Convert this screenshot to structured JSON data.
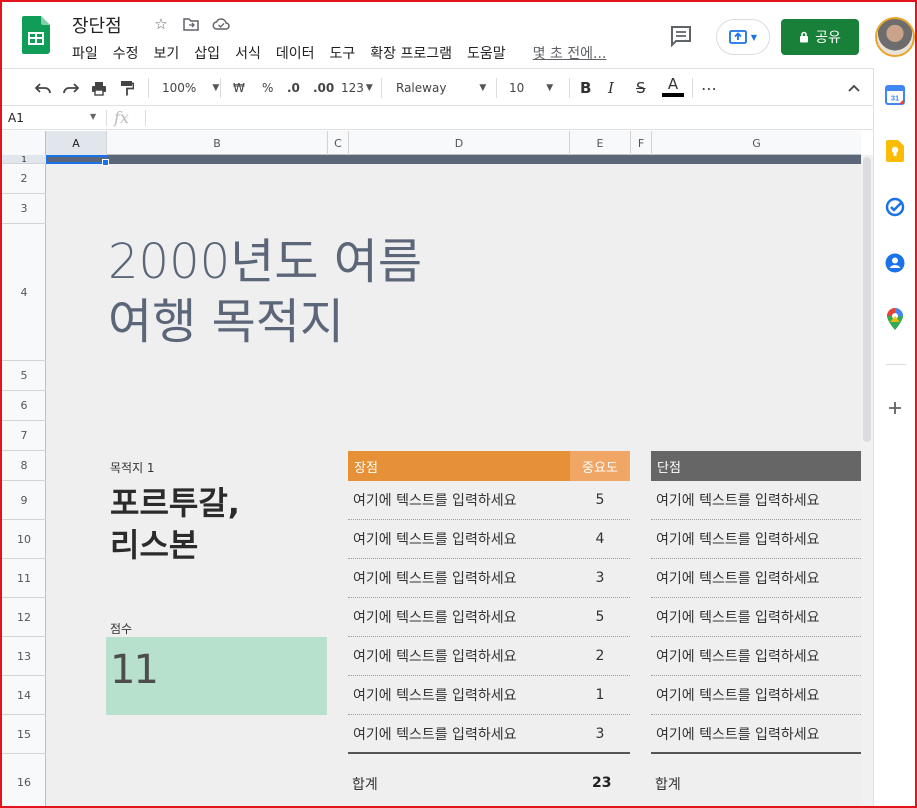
{
  "title_bar": {
    "doc_title": "장단점",
    "menu": [
      "파일",
      "수정",
      "보기",
      "삽입",
      "서식",
      "데이터",
      "도구",
      "확장 프로그램",
      "도움말"
    ],
    "last_edit": "몇 초 전에...",
    "share_label": "공유"
  },
  "toolbar": {
    "zoom": "100%",
    "currency": "₩",
    "percent": "%",
    "dec_decrease": ".0",
    "dec_increase": ".00",
    "number_format": "123",
    "font": "Raleway",
    "font_size": "10",
    "bold": "B",
    "italic": "I",
    "strike": "S",
    "text_color": "A",
    "more": "⋯"
  },
  "formula_bar": {
    "cell_ref": "A1",
    "fx": "fx"
  },
  "columns": [
    "A",
    "B",
    "C",
    "D",
    "E",
    "F",
    "G"
  ],
  "rows": [
    "1",
    "2",
    "3",
    "4",
    "5",
    "6",
    "7",
    "8",
    "9",
    "10",
    "11",
    "12",
    "13",
    "14",
    "15",
    "16"
  ],
  "sheet": {
    "title_line1": "2000년도 여름",
    "title_line2": "여행 목적지",
    "dest_label": "목적지 1",
    "dest_name_line1": "포르투갈,",
    "dest_name_line2": "리스본",
    "score_label": "점수",
    "score_value": "11",
    "pros_header": "장점",
    "importance_header": "중요도",
    "cons_header": "단점",
    "pros": [
      {
        "text": "여기에 텍스트를 입력하세요",
        "importance": "5"
      },
      {
        "text": "여기에 텍스트를 입력하세요",
        "importance": "4"
      },
      {
        "text": "여기에 텍스트를 입력하세요",
        "importance": "3"
      },
      {
        "text": "여기에 텍스트를 입력하세요",
        "importance": "5"
      },
      {
        "text": "여기에 텍스트를 입력하세요",
        "importance": "2"
      },
      {
        "text": "여기에 텍스트를 입력하세요",
        "importance": "1"
      },
      {
        "text": "여기에 텍스트를 입력하세요",
        "importance": "3"
      }
    ],
    "cons": [
      {
        "text": "여기에 텍스트를 입력하세요"
      },
      {
        "text": "여기에 텍스트를 입력하세요"
      },
      {
        "text": "여기에 텍스트를 입력하세요"
      },
      {
        "text": "여기에 텍스트를 입력하세요"
      },
      {
        "text": "여기에 텍스트를 입력하세요"
      },
      {
        "text": "여기에 텍스트를 입력하세요"
      },
      {
        "text": "여기에 텍스트를 입력하세요"
      }
    ],
    "pros_total_label": "합계",
    "pros_total_value": "23",
    "cons_total_label": "합계"
  },
  "side_panel": {
    "icons": [
      "calendar-icon",
      "keep-icon",
      "tasks-icon",
      "contacts-icon",
      "maps-icon",
      "add-addon-icon"
    ],
    "calendar_day": "31"
  },
  "colors": {
    "brand_green": "#188038",
    "header_band": "#5b6679",
    "pros_header": "#e69138",
    "importance_header": "#f0a665",
    "cons_header": "#666666",
    "score_fill": "#b7e1cd"
  }
}
